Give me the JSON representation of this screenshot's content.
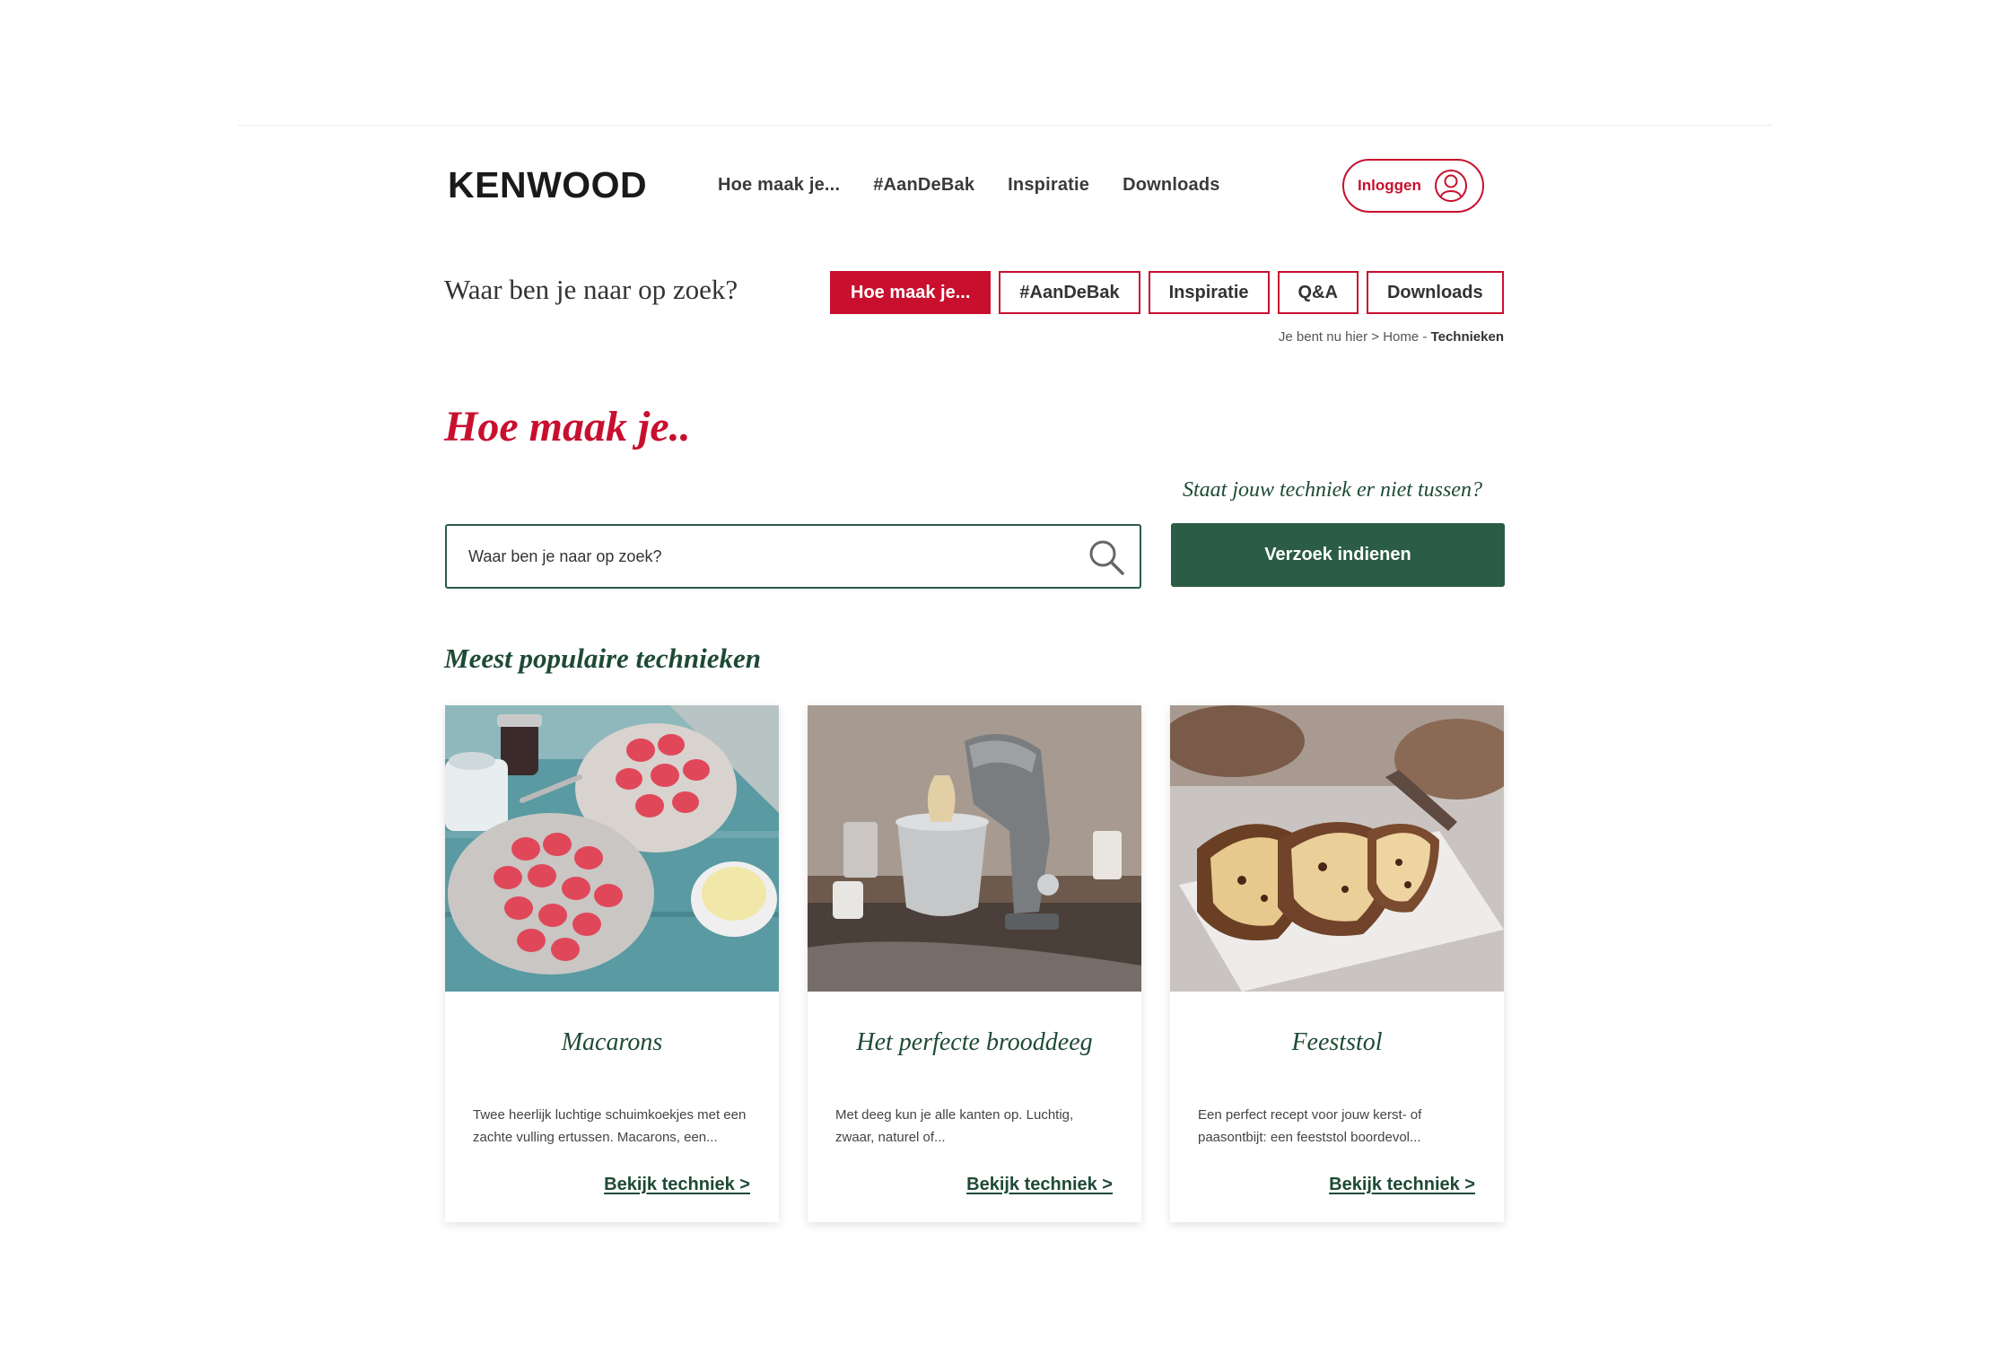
{
  "header": {
    "logo_text": "KENWOOD",
    "nav": [
      "Hoe maak je...",
      "#AanDeBak",
      "Inspiratie",
      "Downloads"
    ],
    "login_label": "Inloggen"
  },
  "finder": {
    "title": "Waar ben je naar op zoek?",
    "tabs": [
      "Hoe maak je...",
      "#AanDeBak",
      "Inspiratie",
      "Q&A",
      "Downloads"
    ],
    "active_tab": "Hoe maak je..."
  },
  "breadcrumb": {
    "prefix": "Je bent nu hier >",
    "home": "Home",
    "separator": "-",
    "current": "Technieken"
  },
  "page": {
    "title": "Hoe maak je..",
    "ask_text": "Staat jouw techniek er niet tussen?",
    "search_placeholder": "Waar ben je naar op zoek?",
    "request_button": "Verzoek indienen",
    "section_title": "Meest populaire technieken"
  },
  "cards": [
    {
      "title": "Macarons",
      "desc": "Twee heerlijk luchtige schuimkoekjes met een zachte vulling ertussen. Macarons, een...",
      "link": "Bekijk techniek >",
      "image": "macarons-photo"
    },
    {
      "title": "Het perfecte brooddeeg",
      "desc": "Met deeg kun je alle kanten op. Luchtig, zwaar, naturel of...",
      "link": "Bekijk techniek >",
      "image": "stand-mixer-photo"
    },
    {
      "title": "Feeststol",
      "desc": "Een perfect recept voor jouw kerst- of paasontbijt: een feeststol boordevol...",
      "link": "Bekijk techniek >",
      "image": "stollen-photo"
    }
  ],
  "colors": {
    "brand_red": "#c8102e",
    "brand_green": "#2b5c45",
    "heading_green": "#1e4a35"
  }
}
